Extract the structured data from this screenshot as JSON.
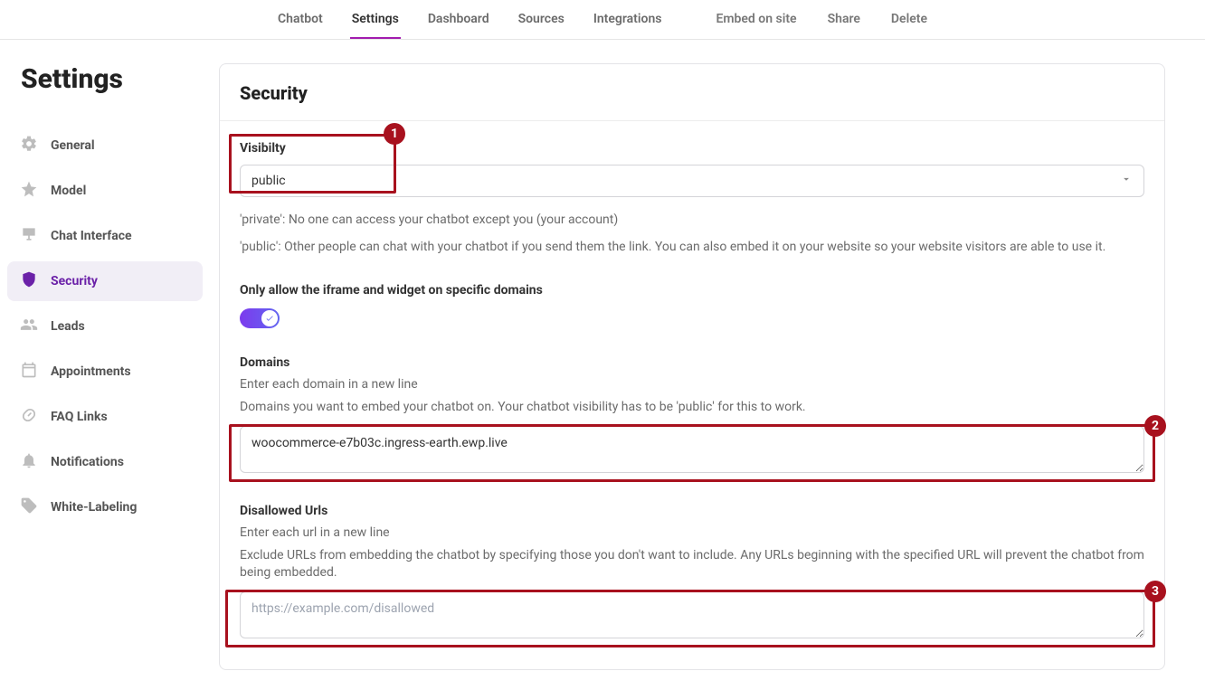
{
  "topnav": {
    "items": [
      {
        "label": "Chatbot",
        "active": false
      },
      {
        "label": "Settings",
        "active": true
      },
      {
        "label": "Dashboard",
        "active": false
      },
      {
        "label": "Sources",
        "active": false
      },
      {
        "label": "Integrations",
        "active": false
      }
    ],
    "right": [
      {
        "label": "Embed on site"
      },
      {
        "label": "Share"
      },
      {
        "label": "Delete"
      }
    ]
  },
  "page": {
    "title": "Settings"
  },
  "sidebar": {
    "items": [
      {
        "label": "General"
      },
      {
        "label": "Model"
      },
      {
        "label": "Chat Interface"
      },
      {
        "label": "Security",
        "active": true
      },
      {
        "label": "Leads"
      },
      {
        "label": "Appointments"
      },
      {
        "label": "FAQ Links"
      },
      {
        "label": "Notifications"
      },
      {
        "label": "White-Labeling"
      }
    ]
  },
  "security": {
    "title": "Security",
    "visibility": {
      "label": "Visibilty",
      "value": "public",
      "hint_private": "'private': No one can access your chatbot except you (your account)",
      "hint_public": "'public': Other people can chat with your chatbot if you send them the link. You can also embed it on your website so your website visitors are able to use it."
    },
    "iframe_toggle": {
      "label": "Only allow the iframe and widget on specific domains",
      "on": true
    },
    "domains": {
      "label": "Domains",
      "subhint": "Enter each domain in a new line",
      "descr": "Domains you want to embed your chatbot on. Your chatbot visibility has to be 'public' for this to work.",
      "value": "woocommerce-e7b03c.ingress-earth.ewp.live"
    },
    "disallowed": {
      "label": "Disallowed Urls",
      "subhint": "Enter each url in a new line",
      "descr": "Exclude URLs from embedding the chatbot by specifying those you don't want to include. Any URLs beginning with the specified URL will prevent the chatbot from being embedded.",
      "placeholder": "https://example.com/disallowed",
      "value": ""
    }
  },
  "callouts": {
    "one": "1",
    "two": "2",
    "three": "3"
  }
}
